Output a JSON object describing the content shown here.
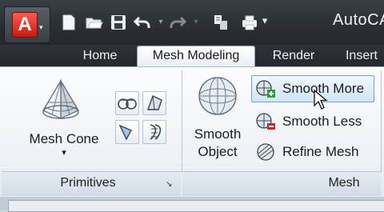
{
  "app": {
    "logo_letter": "A",
    "title": "AutoCA",
    "brand_color": "#d42a1e"
  },
  "quick_access": {
    "icons": [
      "new-icon",
      "open-icon",
      "save-icon",
      "undo-icon",
      "redo-icon",
      "match-properties-icon",
      "plot-icon",
      "customize-icon"
    ]
  },
  "tabs": [
    {
      "label": "Home",
      "active": false
    },
    {
      "label": "Mesh Modeling",
      "active": true
    },
    {
      "label": "Render",
      "active": false
    },
    {
      "label": "Insert",
      "active": false
    }
  ],
  "panels": {
    "primitives": {
      "title": "Primitives",
      "mesh_cone_label_line1": "Mesh Cone",
      "dropdown_glyph": "▾",
      "small_icons": [
        "mesh-cylinder-icon",
        "mesh-wedge-icon",
        "mesh-revolve-icon",
        "mesh-edge-icon"
      ],
      "launcher_glyph": "↘"
    },
    "mesh": {
      "title": "Mesh",
      "smooth_object_line1": "Smooth",
      "smooth_object_line2": "Object",
      "smooth_more": "Smooth More",
      "smooth_less": "Smooth Less",
      "refine_mesh": "Refine Mesh"
    }
  },
  "colors": {
    "hover_border": "#6aa4d8",
    "plus_green": "#2f9d3a",
    "minus_red": "#c8281e"
  }
}
